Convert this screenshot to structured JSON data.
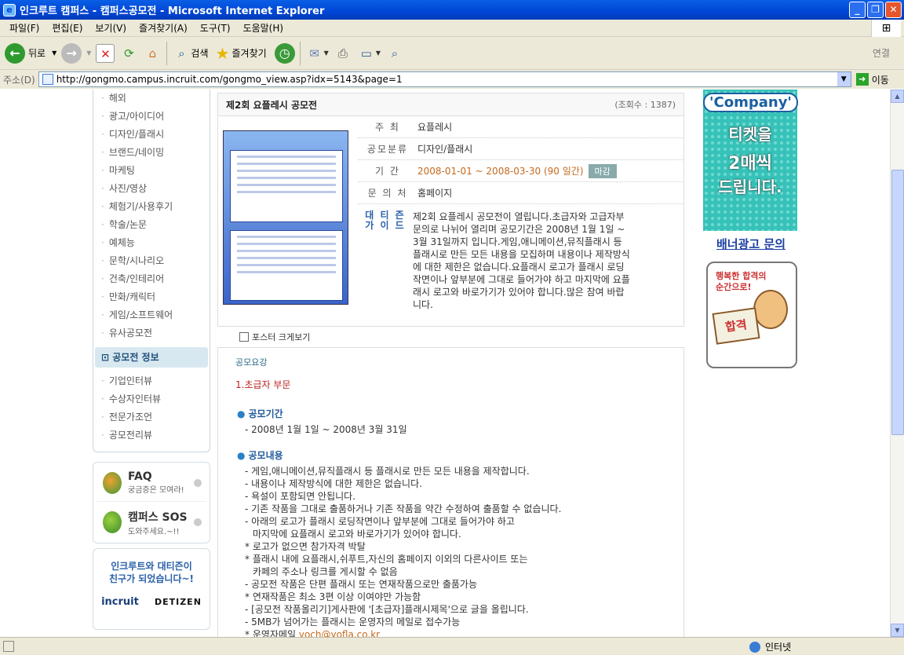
{
  "window": {
    "title": "인크루트 캠퍼스 - 캠퍼스공모전 - Microsoft Internet Explorer"
  },
  "menu": [
    "파일(F)",
    "편집(E)",
    "보기(V)",
    "즐겨찾기(A)",
    "도구(T)",
    "도움말(H)"
  ],
  "toolbar": {
    "back": "뒤로",
    "search": "검색",
    "favorites": "즐겨찾기",
    "connect": "연결"
  },
  "address": {
    "label": "주소(D)",
    "url": "http://gongmo.campus.incruit.com/gongmo_view.asp?idx=5143&page=1",
    "go": "이동"
  },
  "status": {
    "zone": "인터넷"
  },
  "sidebar": {
    "items": [
      "해외",
      "광고/아이디어",
      "디자인/플래시",
      "브랜드/네이밍",
      "마케팅",
      "사진/영상",
      "체험기/사용후기",
      "학술/논문",
      "예체능",
      "문학/시나리오",
      "건축/인테리어",
      "만화/캐릭터",
      "게임/소프트웨어",
      "유사공모전"
    ],
    "section": "공모전 정보",
    "sub_items": [
      "기업인터뷰",
      "수상자인터뷰",
      "전문가조언",
      "공모전리뷰"
    ],
    "faq": {
      "title": "FAQ",
      "sub": "궁금증은 모여라!"
    },
    "sos": {
      "title": "캠퍼스 SOS",
      "sub": "도와주세요.~!!"
    },
    "partner": {
      "text1": "인크루트와 대티즌이",
      "text2": "친구가 되었습니다~!",
      "logo1": "incruit",
      "logo2": "DETIZEN"
    }
  },
  "contest": {
    "title": "제2회 요플레시 공모전",
    "views": "(조회수 : 1387)",
    "host_label": "주 최",
    "host": "요플레시",
    "category_label": "공모분류",
    "category": "디자인/플래시",
    "period_label": "기 간",
    "period": "2008-01-01 ~ 2008-03-30 (90 일간)",
    "closed_badge": "마감",
    "contact_label": "문 의 처",
    "contact": "홈페이지",
    "guide_label_1": "대 티 즌",
    "guide_label_2": "가 이 드",
    "guide": "제2회 요플레시 공모전이 열립니다.초급자와 고급자부문의로 나뉘어 열리며 공모기간은 2008년 1월 1일 ~ 3월 31일까지 입니다.게임,애니메이션,뮤직플래시 등 플래시로 만든 모든 내용을 모집하며 내용이나 제작방식에 대한 제한은 없습니다.요플래시 로고가 플래시 로딩작면이나 앞부분에 그대로 들어가야 하고 마지막에 요플래시 로고와 바로가기가 있어야 합니다.많은 참여 바랍니다.",
    "poster_link": "포스터 크게보기"
  },
  "detail": {
    "label": "공모요강",
    "part": "1.초급자 부문",
    "h_period": "공모기간",
    "period_line": "- 2008년 1월 1일 ~ 2008년 3월 31일",
    "h_content": "공모내용",
    "lines": [
      "- 게임,애니메이션,뮤직플래시 등 플래시로 만든 모든 내용을 제작합니다.",
      "- 내용이나 제작방식에 대한 제한은 없습니다.",
      "- 욕설이 포함되면 안됩니다.",
      "- 기존 작품을 그대로 출품하거나 기존 작품을 약간 수정하여 출품할 수 없습니다.",
      "- 아래의 로고가 플래시 로딩작면이나 앞부분에 그대로 들어가야 하고",
      "  마지막에 요플래시 로고와 바로가기가 있어야 합니다.",
      "* 로고가 없으면 참가자격 박탈",
      "* 플래시 내에 요플래시,쉬푸트,자신의 홈페이지 이외의 다른사이트 또는",
      "  카페의 주소나 링크를 게시할 수 없음",
      "- 공모전 작품은 단편 플래시 또는 연재작품으로만 출품가능",
      "* 연재작품은 최소 3편 이상 이여야만 가능함",
      "- [공모전 작품올리기]게사판에 '[초급자]플래시제목'으로 글을 올립니다.",
      "- 5MB가 넘어가는 플래시는 운영자의 메일로 접수가능"
    ],
    "email_prefix": "* 운영자메일",
    "email": "yoch@yofla.co.kr"
  },
  "ads": {
    "company": "'Company'",
    "line1": "티켓을",
    "line2": "2매씩",
    "line3": "드립니다.",
    "banner_link": "배너광고 문의",
    "pic_text1": "행복한 합격의",
    "pic_text2": "순간으로!",
    "pic_sign": "합격"
  }
}
